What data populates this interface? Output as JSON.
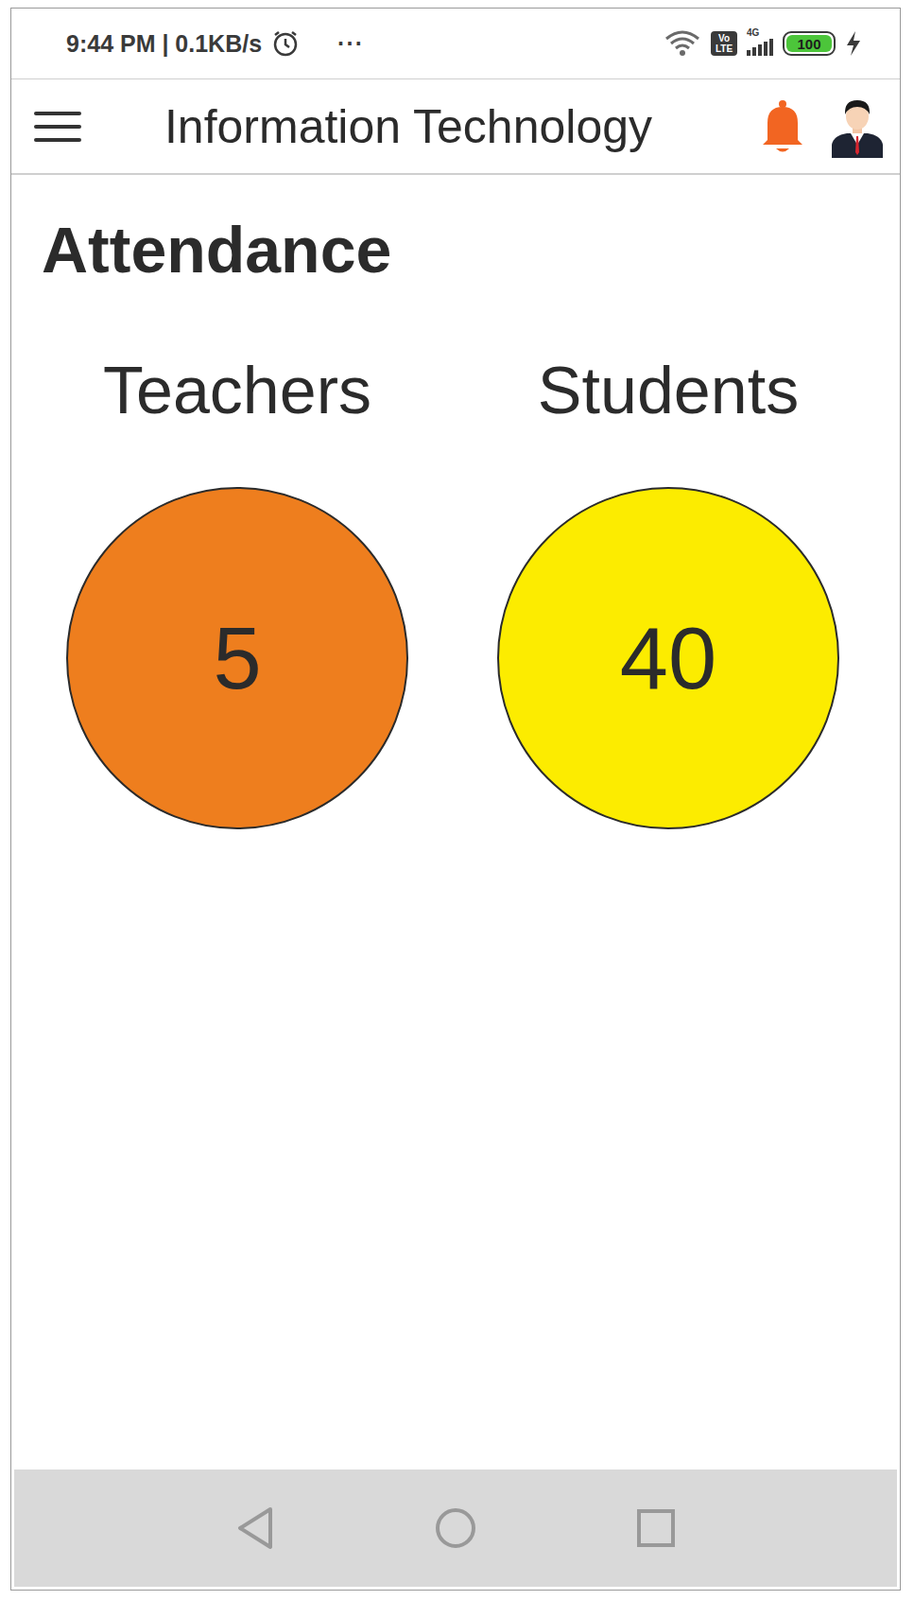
{
  "status_bar": {
    "time": "9:44 PM | 0.1KB/s",
    "more": "···",
    "volte": [
      "Vo",
      "LTE"
    ],
    "network": "4G",
    "battery": "100"
  },
  "header": {
    "title": "Information Technology"
  },
  "section": {
    "title": "Attendance"
  },
  "counters": [
    {
      "label": "Teachers",
      "value": "5",
      "color": "#EE7E1E"
    },
    {
      "label": "Students",
      "value": "40",
      "color": "#FCEC00"
    }
  ]
}
